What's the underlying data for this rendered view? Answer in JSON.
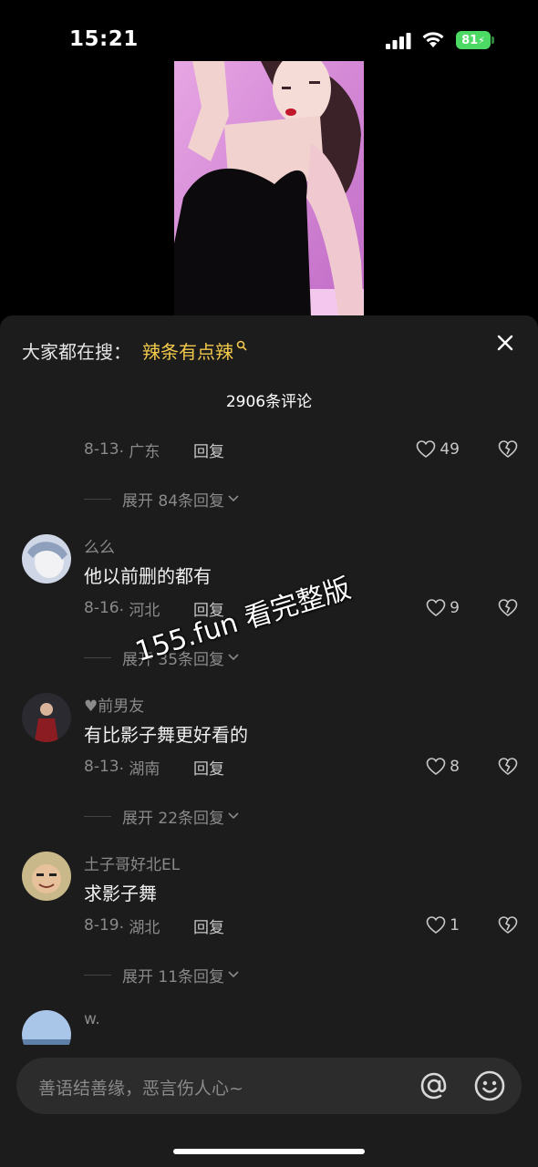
{
  "status_bar": {
    "time": "15:21",
    "battery": "81"
  },
  "search": {
    "prefix": "大家都在搜：",
    "keyword": "辣条有点辣"
  },
  "comments_header": {
    "count_label": "2906条评论"
  },
  "comments": [
    {
      "date": "8-13",
      "location": "· 广东",
      "reply": "回复",
      "likes": "49",
      "expand": "展开 84条回复"
    },
    {
      "username": "么么",
      "text": "他以前删的都有",
      "date": "8-16",
      "location": "· 河北",
      "reply": "回复",
      "likes": "9",
      "expand": "展开 35条回复"
    },
    {
      "username": "前男友",
      "text": "有比影子舞更好看的",
      "date": "8-13",
      "location": "· 湖南",
      "reply": "回复",
      "likes": "8",
      "expand": "展开 22条回复"
    },
    {
      "username": "土子哥好北EL",
      "text": "求影子舞",
      "date": "8-19",
      "location": "· 湖北",
      "reply": "回复",
      "likes": "1",
      "expand": "展开 11条回复"
    },
    {
      "username": "w."
    }
  ],
  "watermark": "155.fun 看完整版",
  "input": {
    "placeholder": "善语结善缘，恶言伤人心~"
  },
  "colors": {
    "keyword": "#f2c94c",
    "sheet_bg": "#1c1c1c",
    "battery": "#4cd964"
  }
}
